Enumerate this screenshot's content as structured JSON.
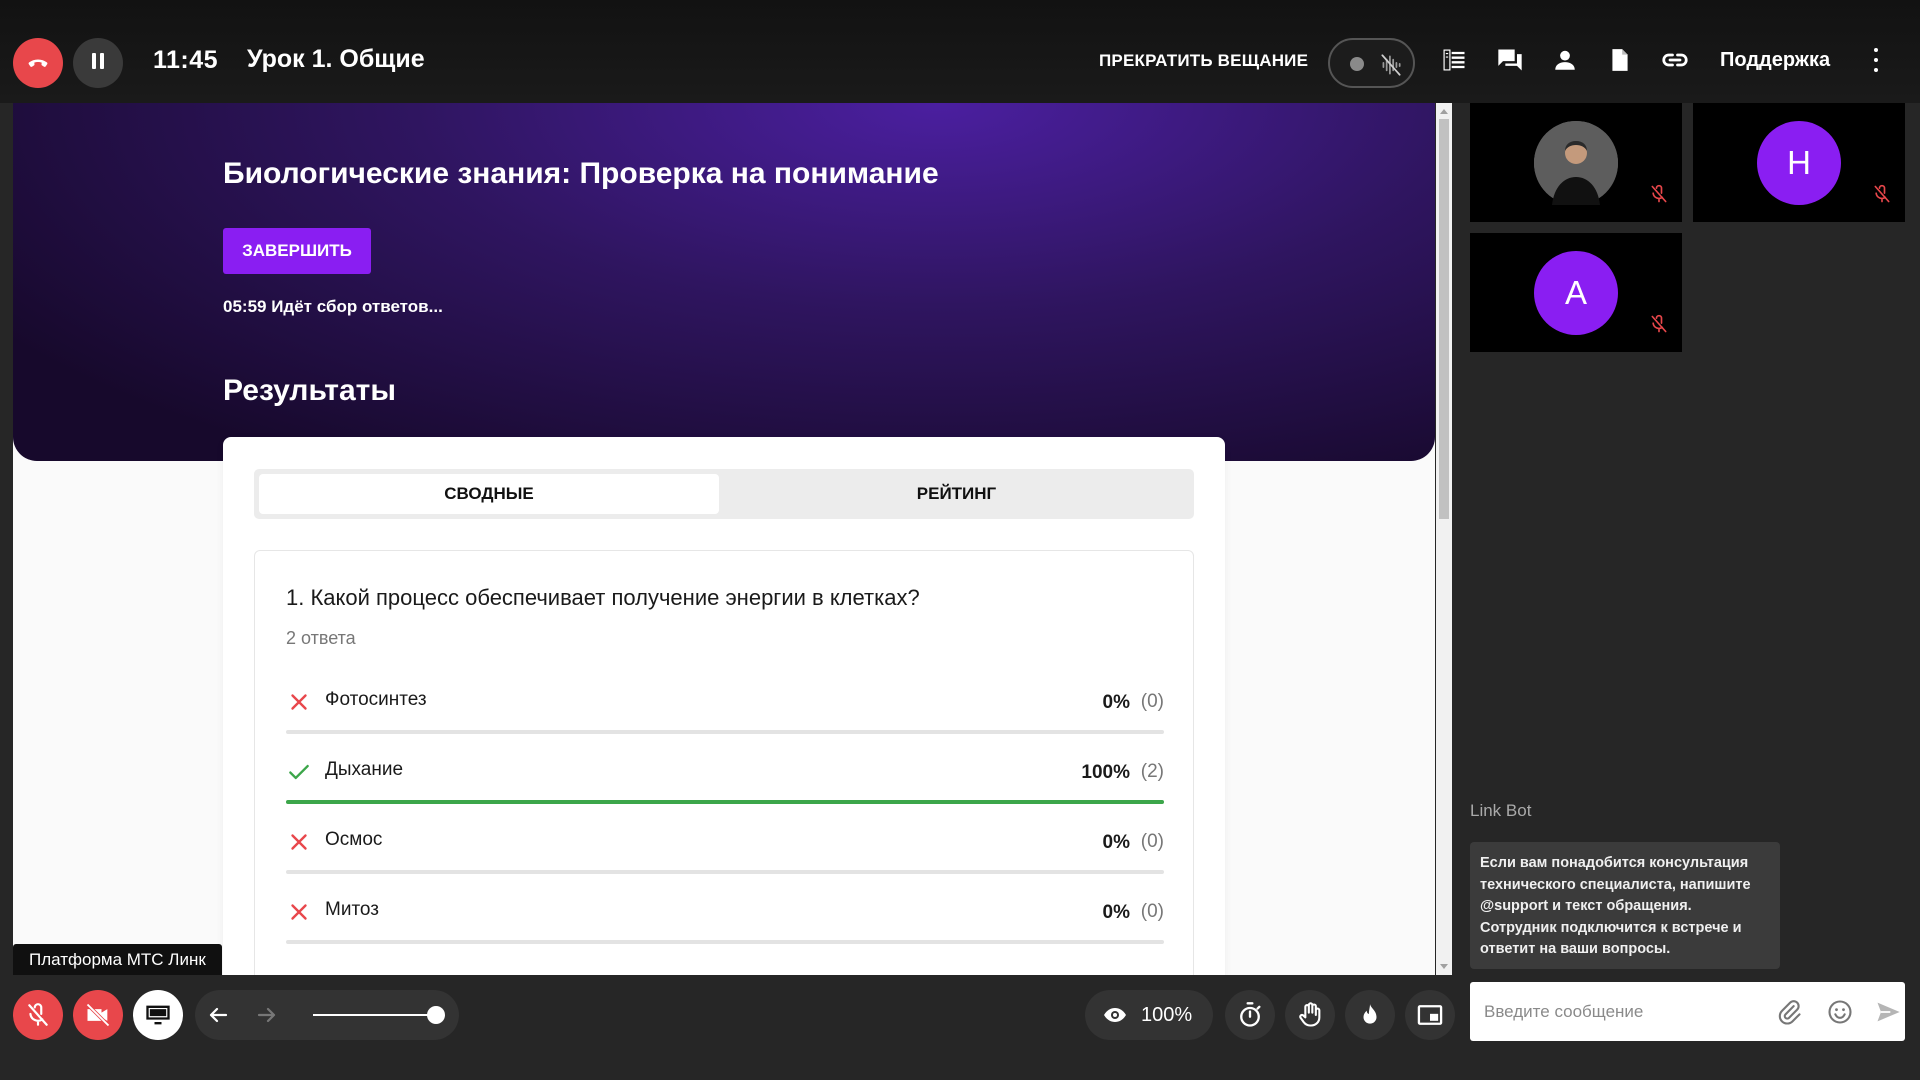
{
  "header": {
    "time": "11:45",
    "lesson_title": "Урок 1. Общие",
    "stop_broadcast_label": "ПРЕКРАТИТЬ ВЕЩАНИЕ",
    "support_label": "Поддержка",
    "icons": [
      "hangup-icon",
      "pause-icon",
      "mic-off-icon",
      "notes-icon",
      "chat-icon",
      "participants-icon",
      "document-icon",
      "link-icon",
      "more-icon"
    ]
  },
  "quiz": {
    "title": "Биологические знания: Проверка на понимание",
    "finish_label": "ЗАВЕРШИТЬ",
    "status": "05:59 Идёт сбор ответов...",
    "results_heading": "Результаты",
    "tabs": [
      {
        "label": "СВОДНЫЕ",
        "active": true
      },
      {
        "label": "РЕЙТИНГ",
        "active": false
      }
    ],
    "question": {
      "text": "1. Какой процесс обеспечивает получение энергии в клетках?",
      "answers_count": "2 ответа",
      "options": [
        {
          "label": "Фотосинтез",
          "percent": "0%",
          "count": "(0)",
          "correct": false,
          "fill": 0
        },
        {
          "label": "Дыхание",
          "percent": "100%",
          "count": "(2)",
          "correct": true,
          "fill": 1
        },
        {
          "label": "Осмос",
          "percent": "0%",
          "count": "(0)",
          "correct": false,
          "fill": 0
        },
        {
          "label": "Митоз",
          "percent": "0%",
          "count": "(0)",
          "correct": false,
          "fill": 0
        }
      ]
    },
    "colors": {
      "accent": "#8a1ef2",
      "correct": "#3ca64a",
      "wrong": "#e8474b"
    }
  },
  "platform_tooltip": "Платформа МТС Линк",
  "participants": [
    {
      "type": "photo",
      "initial": "",
      "muted": true
    },
    {
      "type": "initial",
      "initial": "Н",
      "muted": true,
      "color": "#8a1ef2"
    },
    {
      "type": "initial",
      "initial": "А",
      "muted": true,
      "color": "#8a1ef2"
    }
  ],
  "chat": {
    "bot_name": "Link Bot",
    "bot_message": "Если вам понадобится консультация технического специалиста, напишите @support и текст обращения. Сотрудник подключится к встрече и ответит на ваши вопросы.",
    "input_placeholder": "Введите сообщение"
  },
  "bottom_bar": {
    "view_percent": "100%",
    "slider_level": 1,
    "icons": [
      "mic-off-icon",
      "camera-off-icon",
      "screen-share-icon",
      "back-arrow-icon",
      "forward-arrow-icon",
      "eye-icon",
      "timer-icon",
      "raise-hand-icon",
      "fire-icon",
      "picture-in-picture-icon"
    ]
  }
}
